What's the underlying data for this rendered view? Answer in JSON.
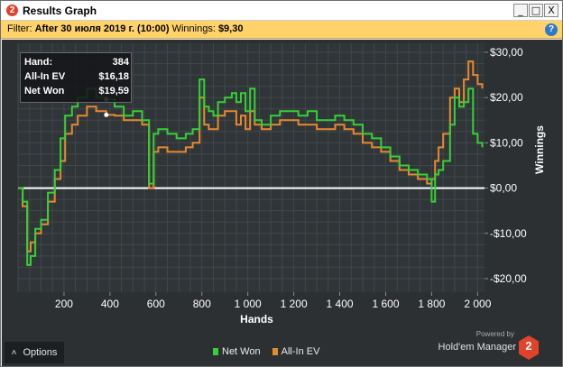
{
  "window": {
    "title": "Results Graph",
    "icon_label": "2",
    "controls": {
      "minimize": "_",
      "maximize": "□",
      "close": "X"
    }
  },
  "filter": {
    "label": "Filter:",
    "value": "After 30 июля 2019 г. (10:00)",
    "winnings_label": "Winnings:",
    "winnings_value": "$9,30",
    "help": "?"
  },
  "tooltip": {
    "rows": [
      {
        "key": "Hand:",
        "value": "384"
      },
      {
        "key": "All-In EV",
        "value": "$16,18"
      },
      {
        "key": "Net Won",
        "value": "$19,59"
      }
    ]
  },
  "colors": {
    "panel": "#2c3033",
    "plot": "#303538",
    "grid": "#41474b",
    "net_won": "#36d136",
    "all_in_ev": "#e8892e",
    "zero_line": "#ffffff",
    "text": "#ffffff"
  },
  "chart_data": {
    "type": "line",
    "xlabel": "Hands",
    "ylabel": "Winnings",
    "xlim": [
      0,
      2030
    ],
    "ylim": [
      -23,
      32
    ],
    "xticks": [
      200,
      400,
      600,
      800,
      1000,
      1200,
      1400,
      1600,
      1800,
      2000
    ],
    "xtick_labels": [
      "200",
      "400",
      "600",
      "800",
      "1 000",
      "1 200",
      "1 400",
      "1 600",
      "1 800",
      "2 000"
    ],
    "yticks": [
      30,
      20,
      10,
      0,
      -10,
      -20
    ],
    "ytick_labels": [
      "$30,00",
      "$20,00",
      "$10,00",
      "$0,00",
      "-$10,00",
      "-$20,00"
    ],
    "grid": true,
    "legend": "bottom-center",
    "series": [
      {
        "name": "Net Won",
        "color": "#36d136",
        "x": [
          0,
          20,
          40,
          55,
          75,
          100,
          130,
          160,
          185,
          205,
          235,
          260,
          300,
          340,
          384,
          420,
          460,
          500,
          540,
          570,
          590,
          610,
          650,
          690,
          730,
          760,
          790,
          810,
          830,
          850,
          870,
          900,
          930,
          950,
          970,
          990,
          1010,
          1030,
          1060,
          1100,
          1140,
          1180,
          1220,
          1260,
          1300,
          1340,
          1380,
          1420,
          1460,
          1500,
          1540,
          1580,
          1620,
          1660,
          1700,
          1740,
          1780,
          1800,
          1815,
          1830,
          1850,
          1880,
          1900,
          1920,
          1940,
          1960,
          1980,
          2000,
          2020
        ],
        "y": [
          0,
          -3,
          -17,
          -15,
          -9,
          -7,
          -1,
          4,
          11,
          16,
          18,
          20,
          22,
          20,
          19.59,
          18,
          16,
          17,
          15,
          1,
          12,
          13,
          12,
          11,
          12,
          13,
          24,
          18,
          17,
          16,
          19,
          20,
          21,
          19,
          21,
          17,
          22,
          15,
          14,
          16,
          17,
          17,
          16,
          17,
          15,
          15,
          16,
          15,
          14,
          12,
          11,
          9,
          7,
          5,
          4,
          3,
          2,
          -3,
          3,
          4,
          6,
          14,
          20,
          18,
          19,
          22,
          12,
          10,
          9
        ]
      },
      {
        "name": "All-In EV",
        "color": "#e8892e",
        "x": [
          0,
          20,
          40,
          55,
          75,
          100,
          130,
          160,
          185,
          205,
          235,
          260,
          300,
          340,
          384,
          420,
          460,
          500,
          540,
          570,
          590,
          610,
          650,
          690,
          730,
          760,
          790,
          810,
          830,
          850,
          870,
          900,
          930,
          950,
          970,
          990,
          1010,
          1030,
          1060,
          1100,
          1140,
          1180,
          1220,
          1260,
          1300,
          1340,
          1380,
          1420,
          1460,
          1500,
          1540,
          1580,
          1620,
          1660,
          1700,
          1740,
          1780,
          1800,
          1815,
          1830,
          1850,
          1880,
          1900,
          1920,
          1940,
          1960,
          1980,
          2000,
          2020
        ],
        "y": [
          0,
          -4,
          -14,
          -12,
          -10,
          -8,
          -3,
          2,
          6,
          12,
          14,
          16,
          18,
          17,
          16.18,
          16,
          15,
          15,
          14,
          0,
          8,
          9,
          8,
          8,
          9,
          10,
          20,
          14,
          13,
          13,
          16,
          17,
          17,
          14,
          16,
          13,
          17,
          14,
          13,
          14,
          15,
          15,
          14,
          14,
          13,
          13,
          14,
          13,
          12,
          10,
          9,
          8,
          6,
          4,
          3,
          2,
          1,
          2,
          6,
          9,
          12,
          20,
          22,
          19,
          24,
          28,
          25,
          23,
          22
        ]
      }
    ]
  },
  "legend": [
    {
      "label": "Net Won",
      "color": "#36d136"
    },
    {
      "label": "All-In EV",
      "color": "#e8892e"
    }
  ],
  "footer": {
    "options_label": "Options",
    "powered_by": "Powered by",
    "brand": "Hold'em Manager",
    "logo_label": "2",
    "logo_color": "#e0422a"
  }
}
